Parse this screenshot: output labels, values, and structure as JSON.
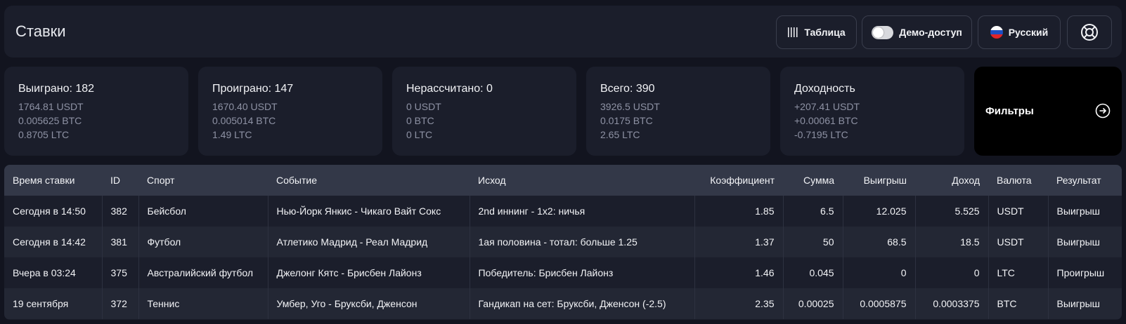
{
  "header": {
    "title": "Ставки",
    "table_label": "Таблица",
    "demo_label": "Демо-доступ",
    "lang_label": "Русский"
  },
  "stats": [
    {
      "title": "Выиграно: 182",
      "lines": [
        "1764.81 USDT",
        "0.005625 BTC",
        "0.8705 LTC"
      ]
    },
    {
      "title": "Проиграно: 147",
      "lines": [
        "1670.40 USDT",
        "0.005014 BTC",
        "1.49 LTC"
      ]
    },
    {
      "title": "Нерассчитано: 0",
      "lines": [
        "0 USDT",
        "0 BTC",
        "0 LTC"
      ]
    },
    {
      "title": "Всего: 390",
      "lines": [
        "3926.5 USDT",
        "0.0175 BTC",
        "2.65 LTC"
      ]
    },
    {
      "title": "Доходность",
      "lines": [
        "+207.41 USDT",
        "+0.00061 BTC",
        "-0.7195 LTC"
      ]
    }
  ],
  "filters": {
    "label": "Фильтры"
  },
  "table": {
    "columns": [
      "Время ставки",
      "ID",
      "Спорт",
      "Событие",
      "Исход",
      "Коэффициент",
      "Сумма",
      "Выигрыш",
      "Доход",
      "Валюта",
      "Результат"
    ],
    "rows": [
      [
        "Сегодня в 14:50",
        "382",
        "Бейсбол",
        "Нью-Йорк Янкис - Чикаго Вайт Сокс",
        "2nd иннинг - 1x2: ничья",
        "1.85",
        "6.5",
        "12.025",
        "5.525",
        "USDT",
        "Выигрыш"
      ],
      [
        "Сегодня в 14:42",
        "381",
        "Футбол",
        "Атлетико Мадрид - Реал Мадрид",
        "1ая половина - тотал: больше 1.25",
        "1.37",
        "50",
        "68.5",
        "18.5",
        "USDT",
        "Выигрыш"
      ],
      [
        "Вчера в 03:24",
        "375",
        "Австралийский футбол",
        "Джелонг Кятс - Брисбен Лайонз",
        "Победитель: Брисбен Лайонз",
        "1.46",
        "0.045",
        "0",
        "0",
        "LTC",
        "Проигрыш"
      ],
      [
        "19 сентября",
        "372",
        "Теннис",
        "Умбер, Уго - Бруксби, Дженсон",
        "Гандикап на сет: Бруксби, Дженсон (-2.5)",
        "2.35",
        "0.00025",
        "0.0005875",
        "0.0003375",
        "BTC",
        "Выигрыш"
      ]
    ]
  },
  "colors": {
    "background": "#12141f",
    "card": "#1b1e2b",
    "header_row": "#333848"
  },
  "icons": [
    "table-icon",
    "toggle-icon",
    "russia-flag-icon",
    "lifebuoy-icon",
    "arrow-right-circle-icon"
  ]
}
